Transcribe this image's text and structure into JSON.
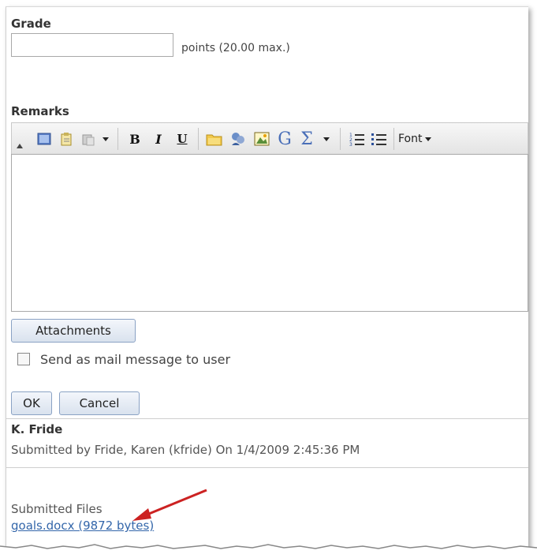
{
  "grade": {
    "label": "Grade",
    "input_value": "",
    "points_text": "points (20.00 max.)"
  },
  "remarks": {
    "label": "Remarks",
    "toolbar": {
      "font_label": "Font",
      "icons": [
        "collapse-icon",
        "select-all-icon",
        "paste-icon",
        "paste-special-icon",
        "dropdown-arrow-icon",
        "bold-icon",
        "italic-icon",
        "underline-icon",
        "insert-file-icon",
        "insert-link-icon",
        "insert-image-icon",
        "google-icon",
        "equation-icon",
        "dropdown-arrow-icon",
        "numbered-list-icon",
        "bulleted-list-icon"
      ],
      "bold": "B",
      "italic": "I",
      "underline": "U",
      "google": "G",
      "sigma": "Σ"
    },
    "editor_content": ""
  },
  "buttons": {
    "attachments": "Attachments",
    "ok": "OK",
    "cancel": "Cancel"
  },
  "mail_option": {
    "label": "Send as mail message to user",
    "checked": false
  },
  "submission": {
    "name": "K. Fride",
    "submitted_by": "Submitted by Fride, Karen (kfride) On 1/4/2009 2:45:36 PM",
    "files_label": "Submitted Files",
    "file_link": "goals.docx (9872 bytes)"
  },
  "colors": {
    "link": "#3366aa",
    "arrow": "#cc2222",
    "button_border": "#8aa2c4"
  }
}
